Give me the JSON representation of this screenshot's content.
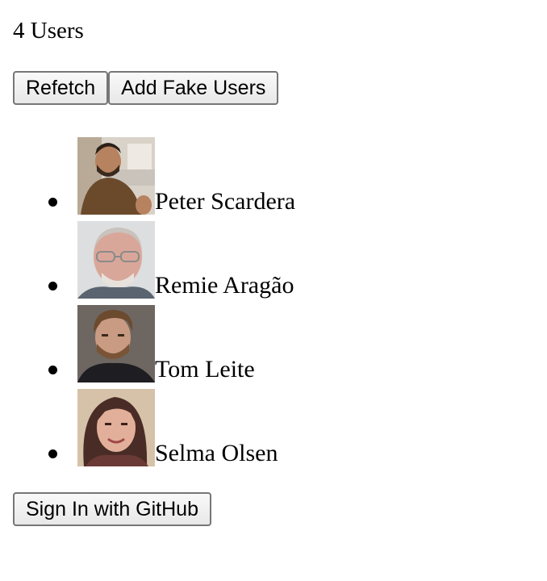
{
  "header": {
    "user_count": "4 Users"
  },
  "toolbar": {
    "refetch_label": "Refetch",
    "add_fake_label": "Add Fake Users"
  },
  "users": [
    {
      "name": "Peter Scardera"
    },
    {
      "name": "Remie Aragão"
    },
    {
      "name": "Tom Leite"
    },
    {
      "name": "Selma Olsen"
    }
  ],
  "footer": {
    "signin_label": "Sign In with GitHub"
  }
}
